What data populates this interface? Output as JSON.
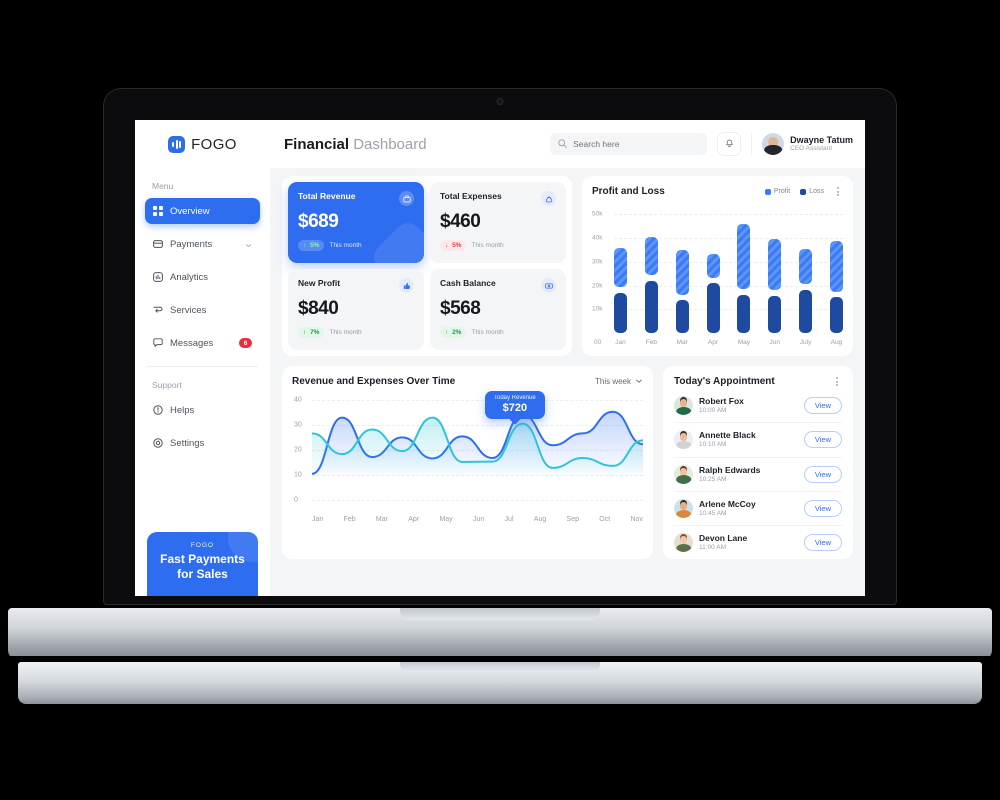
{
  "brand": {
    "name": "FOGO",
    "icon": "bar-logo-icon"
  },
  "sidebar": {
    "menu_label": "Menu",
    "items": [
      {
        "label": "Overview",
        "icon": "grid-icon",
        "active": true
      },
      {
        "label": "Payments",
        "icon": "card-icon",
        "chevron": true
      },
      {
        "label": "Analytics",
        "icon": "chart-icon"
      },
      {
        "label": "Services",
        "icon": "services-icon"
      },
      {
        "label": "Messages",
        "icon": "message-icon",
        "badge": "6"
      }
    ],
    "support_label": "Support",
    "support_items": [
      {
        "label": "Helps",
        "icon": "help-circle-icon"
      },
      {
        "label": "Settings",
        "icon": "gear-icon"
      }
    ],
    "promo": {
      "kicker": "FOGO",
      "line1": "Fast Payments",
      "line2": "for Sales"
    }
  },
  "header": {
    "title_bold": "Financial",
    "title_light": " Dashboard",
    "search_placeholder": "Search here",
    "search_value": "",
    "search_icon": "search-icon",
    "bell_icon": "bell-icon",
    "user": {
      "name": "Dwayne Tatum",
      "role": "CEO Assistant"
    }
  },
  "stats": [
    {
      "title": "Total Revenue",
      "value": "$689",
      "delta": "5%",
      "dir": "up",
      "period": "This month",
      "icon": "wallet-icon",
      "highlight": true
    },
    {
      "title": "Total Expenses",
      "value": "$460",
      "delta": "5%",
      "dir": "down",
      "period": "This month",
      "icon": "bag-icon",
      "highlight": false
    },
    {
      "title": "New Profit",
      "value": "$840",
      "delta": "7%",
      "dir": "up",
      "period": "This month",
      "icon": "thumb-up-icon",
      "highlight": false
    },
    {
      "title": "Cash Balance",
      "value": "$568",
      "delta": "2%",
      "dir": "up",
      "period": "This month",
      "icon": "money-icon",
      "highlight": false
    }
  ],
  "profit_loss": {
    "title": "Profit and Loss",
    "menu_icon": "kebab-menu-icon",
    "zero_label": "00"
  },
  "revenue_chart": {
    "title": "Revenue and Expenses Over Time",
    "range_label": "This week",
    "range_icon": "chevron-down-icon",
    "tooltip": {
      "label": "Today Revenue",
      "value": "$720"
    }
  },
  "appointments": {
    "title": "Today's Appointment",
    "menu_icon": "kebab-menu-icon",
    "view_label": "View",
    "items": [
      {
        "name": "Robert Fox",
        "time": "10:00 AM",
        "skin": "#e7b48c",
        "hair": "#2e2a27",
        "shirt": "#1f6b4a",
        "bg": "#d9e7de"
      },
      {
        "name": "Annette Black",
        "time": "10:10 AM",
        "skin": "#e8bd99",
        "hair": "#3a2f29",
        "shirt": "#cfd3d8",
        "bg": "#eceef1"
      },
      {
        "name": "Ralph Edwards",
        "time": "10:25 AM",
        "skin": "#f0c3a0",
        "hair": "#5b3a22",
        "shirt": "#3f6f48",
        "bg": "#e3ebdf"
      },
      {
        "name": "Arlene McCoy",
        "time": "10:45 AM",
        "skin": "#e5b189",
        "hair": "#2b2724",
        "shirt": "#d8873f",
        "bg": "#cfe0ea"
      },
      {
        "name": "Devon Lane",
        "time": "11:00 AM",
        "skin": "#f1c7a5",
        "hair": "#8a4a2a",
        "shirt": "#5c6f4a",
        "bg": "#e6ded2"
      }
    ]
  },
  "chart_data": [
    {
      "type": "bar",
      "title": "Profit and Loss",
      "xlabel": "",
      "ylabel": "",
      "categories": [
        "Jan",
        "Feb",
        "Mar",
        "Apr",
        "May",
        "Jun",
        "July",
        "Aug"
      ],
      "ytick_labels": [
        "50k",
        "40k",
        "30k",
        "20k",
        "10k"
      ],
      "ytick_values": [
        50,
        40,
        30,
        20,
        10
      ],
      "ylim": [
        0,
        54
      ],
      "grid": true,
      "legend": [
        {
          "name": "Profit",
          "color": "#3b7bf5"
        },
        {
          "name": "Loss",
          "color": "#1e4ba0"
        }
      ],
      "series": [
        {
          "name": "Loss",
          "color": "#1e4ba0",
          "values": [
            17,
            22,
            14,
            21,
            16,
            15.5,
            18,
            15
          ]
        },
        {
          "name": "Profit",
          "color": "#3b7bf5",
          "start": [
            19.5,
            24.5,
            16,
            23,
            18.5,
            18,
            20.5,
            17.5
          ],
          "values": [
            36,
            40.5,
            35,
            33.5,
            46,
            39.5,
            35.5,
            39
          ]
        }
      ]
    },
    {
      "type": "line",
      "title": "Revenue and Expenses Over Time",
      "xlabel": "",
      "ylabel": "",
      "categories": [
        "Jan",
        "Feb",
        "Mar",
        "Apr",
        "May",
        "Jun",
        "Jul",
        "Aug",
        "Sep",
        "Oct",
        "Nov"
      ],
      "ytick_labels": [
        "40",
        "30",
        "20",
        "10",
        "0"
      ],
      "ytick_values": [
        40,
        30,
        20,
        10,
        0
      ],
      "ylim": [
        0,
        42
      ],
      "grid": true,
      "annotation": {
        "at": "Jul",
        "label": "Today Revenue",
        "value": 32,
        "value_text": "$720"
      },
      "series": [
        {
          "name": "Revenue",
          "color": "#2f6df0",
          "values": [
            2,
            30.5,
            10.5,
            20.5,
            9.8,
            21,
            10,
            32,
            16.5,
            22.5,
            33.5,
            17
          ]
        },
        {
          "name": "Expenses",
          "color": "#2ec5d8",
          "values": [
            22.5,
            12,
            24.5,
            13.5,
            30.5,
            8,
            8.2,
            27.5,
            5,
            10,
            6,
            19
          ]
        }
      ]
    }
  ]
}
